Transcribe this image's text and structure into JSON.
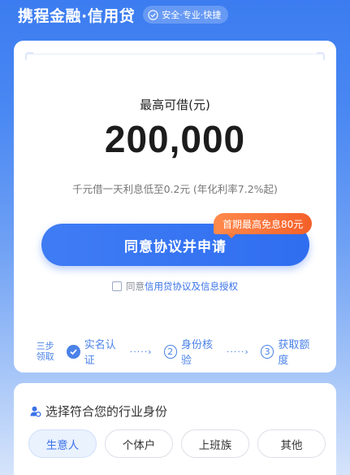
{
  "header": {
    "brand": "携程金融·信用贷",
    "slogan": "安全·专业·快捷",
    "slogan_icon": "shield-check-icon"
  },
  "loan_card": {
    "amount_label": "最高可借(元)",
    "amount": "200,000",
    "rate_note": "千元借一天利息低至0.2元 (年化利率7.2%起)",
    "apply_button": "同意协议并申请",
    "promo_badge": "首期最高免息80元",
    "agreement_prefix": "同意",
    "agreement_link": "信用贷协议及信息授权",
    "agreement_checked": false,
    "steps_title": "三步领取",
    "steps": [
      {
        "num": "",
        "label": "实名认证",
        "done": true
      },
      {
        "num": "2",
        "label": "身份核验",
        "done": false
      },
      {
        "num": "3",
        "label": "获取额度",
        "done": false
      }
    ]
  },
  "identity": {
    "title": "选择符合您的行业身份",
    "title_icon": "person-icon",
    "options": [
      {
        "label": "生意人",
        "selected": true
      },
      {
        "label": "个体户",
        "selected": false
      },
      {
        "label": "上班族",
        "selected": false
      },
      {
        "label": "其他",
        "selected": false
      }
    ]
  },
  "colors": {
    "accent": "#3a72e8",
    "promo": "#f4602a",
    "background_top": "#3b7cf0"
  }
}
